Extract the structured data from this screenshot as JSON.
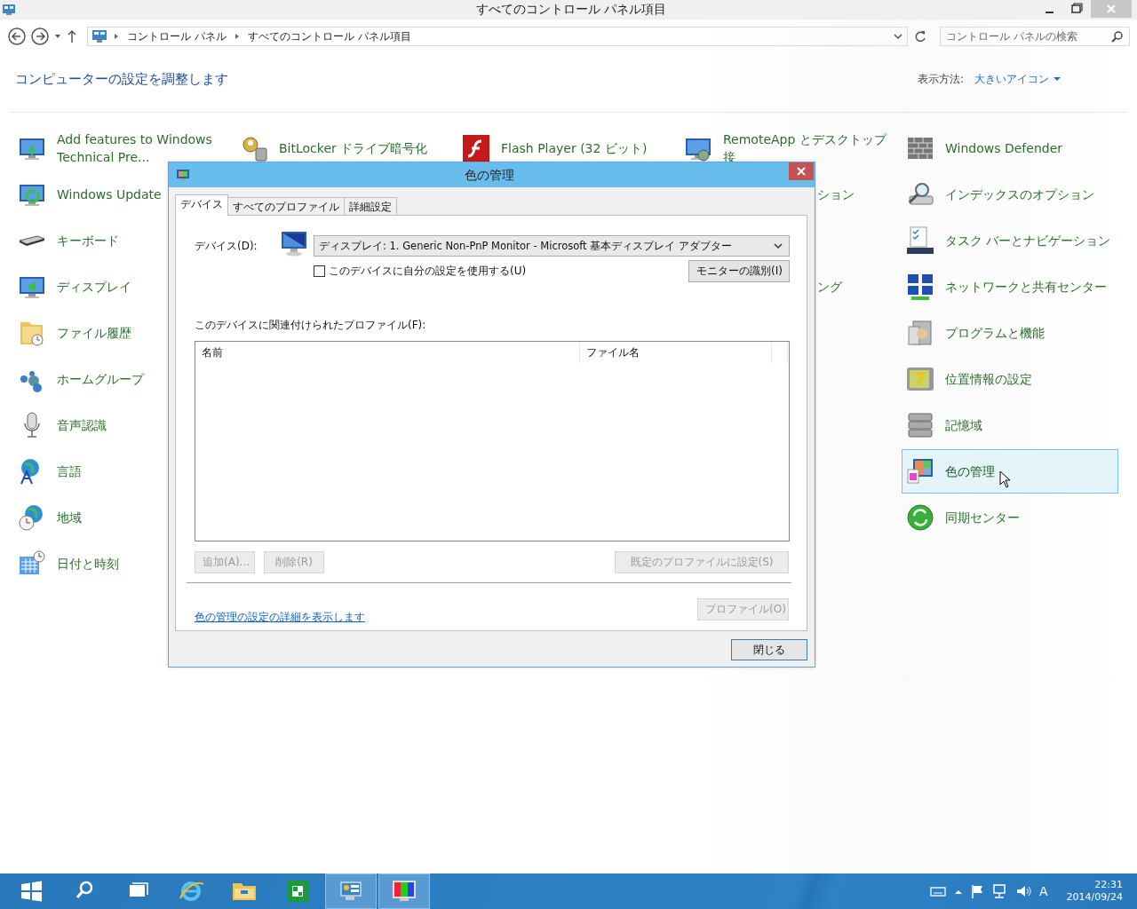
{
  "window": {
    "title": "すべてのコントロール パネル項目"
  },
  "address_bar": {
    "breadcrumbs": [
      "コントロール パネル",
      "すべてのコントロール パネル項目"
    ]
  },
  "search": {
    "placeholder": "コントロール パネルの検索"
  },
  "heading": "コンピューターの設定を調整します",
  "view_by": {
    "label": "表示方法:",
    "value": "大きいアイコン"
  },
  "columns": [
    [
      {
        "kind": "item",
        "label": "Add features to Windows Technical Pre...",
        "selected": false
      },
      {
        "kind": "item",
        "label": "Windows Update",
        "selected": false
      },
      {
        "kind": "item",
        "label": "キーボード",
        "selected": false
      },
      {
        "kind": "item",
        "label": "ディスプレイ",
        "selected": false
      },
      {
        "kind": "item",
        "label": "ファイル履歴",
        "selected": false
      },
      {
        "kind": "item",
        "label": "ホームグループ",
        "selected": false
      },
      {
        "kind": "item",
        "label": "音声認識",
        "selected": false
      },
      {
        "kind": "item",
        "label": "言語",
        "selected": false
      },
      {
        "kind": "item",
        "label": "地域",
        "selected": false
      },
      {
        "kind": "item",
        "label": "日付と時刻",
        "selected": false
      }
    ],
    [
      {
        "kind": "item",
        "label": "BitLocker ドライブ暗号化",
        "selected": false
      }
    ],
    [
      {
        "kind": "item",
        "label": "Flash Player (32 ビット)",
        "selected": false
      }
    ],
    [
      {
        "kind": "item",
        "label": "RemoteApp とデスクトップ接",
        "selected": false
      },
      {
        "kind": "fragment",
        "label": "ション",
        "selected": false
      },
      {
        "kind": "covered"
      },
      {
        "kind": "fragment",
        "label": "ング",
        "selected": false
      }
    ],
    [
      {
        "kind": "item",
        "label": "Windows Defender",
        "selected": false
      },
      {
        "kind": "item",
        "label": "インデックスのオプション",
        "selected": false
      },
      {
        "kind": "item",
        "label": "タスク バーとナビゲーション",
        "selected": false
      },
      {
        "kind": "item",
        "label": "ネットワークと共有センター",
        "selected": false
      },
      {
        "kind": "item",
        "label": "プログラムと機能",
        "selected": false
      },
      {
        "kind": "item",
        "label": "位置情報の設定",
        "selected": false
      },
      {
        "kind": "item",
        "label": "記憶域",
        "selected": false
      },
      {
        "kind": "item",
        "label": "色の管理",
        "selected": true
      },
      {
        "kind": "item",
        "label": "同期センター",
        "selected": false
      }
    ]
  ],
  "dialog": {
    "title": "色の管理",
    "tabs": [
      {
        "label": "デバイス",
        "selected": true
      },
      {
        "label": "すべてのプロファイル",
        "selected": false
      },
      {
        "label": "詳細設定",
        "selected": false
      }
    ],
    "device_label": "デバイス(D):",
    "device_value": "ディスプレイ: 1. Generic Non-PnP Monitor - Microsoft 基本ディスプレイ アダプター",
    "own_settings": {
      "label": "このデバイスに自分の設定を使用する(U)",
      "checked": false
    },
    "identify_button": {
      "label": "モニターの識別(I)",
      "disabled": false
    },
    "profiles_label": "このデバイスに関連付けられたプロファイル(F):",
    "profile_columns": [
      "名前",
      "ファイル名"
    ],
    "list_buttons": [
      {
        "label": "追加(A)...",
        "disabled": true
      },
      {
        "label": "削除(R)",
        "disabled": true
      },
      {
        "label": "既定のプロファイルに設定(S)",
        "disabled": true
      }
    ],
    "link": "色の管理の設定の詳細を表示します",
    "profiles_button": {
      "label": "プロファイル(O)",
      "disabled": true
    },
    "close_button": "閉じる"
  },
  "taskbar": {
    "apps": [
      {
        "running": false
      },
      {
        "running": false
      },
      {
        "running": false
      },
      {
        "running": false
      },
      {
        "running": false
      },
      {
        "running": false
      },
      {
        "running": true
      },
      {
        "running": true
      }
    ],
    "ime": "A",
    "time": "22:31",
    "date": "2014/09/24"
  }
}
